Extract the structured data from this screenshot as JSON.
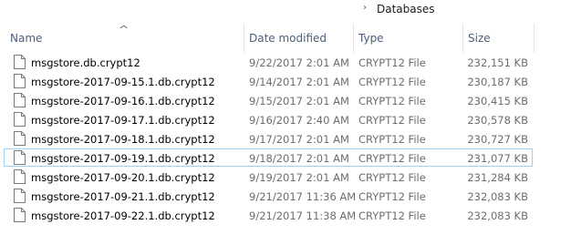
{
  "breadcrumb": {
    "separator": "›",
    "current": "Databases"
  },
  "columns": {
    "name": "Name",
    "date_modified": "Date modified",
    "type": "Type",
    "size": "Size"
  },
  "sort": {
    "column": "name",
    "glyph": "^"
  },
  "files": [
    {
      "name": "msgstore.db.crypt12",
      "date": "9/22/2017 2:01 AM",
      "type": "CRYPT12 File",
      "size": "232,151 KB",
      "selected": false
    },
    {
      "name": "msgstore-2017-09-15.1.db.crypt12",
      "date": "9/14/2017 2:01 AM",
      "type": "CRYPT12 File",
      "size": "230,187 KB",
      "selected": false
    },
    {
      "name": "msgstore-2017-09-16.1.db.crypt12",
      "date": "9/15/2017 2:01 AM",
      "type": "CRYPT12 File",
      "size": "230,415 KB",
      "selected": false
    },
    {
      "name": "msgstore-2017-09-17.1.db.crypt12",
      "date": "9/16/2017 2:40 AM",
      "type": "CRYPT12 File",
      "size": "230,578 KB",
      "selected": false
    },
    {
      "name": "msgstore-2017-09-18.1.db.crypt12",
      "date": "9/17/2017 2:01 AM",
      "type": "CRYPT12 File",
      "size": "230,727 KB",
      "selected": false
    },
    {
      "name": "msgstore-2017-09-19.1.db.crypt12",
      "date": "9/18/2017 2:01 AM",
      "type": "CRYPT12 File",
      "size": "231,077 KB",
      "selected": true
    },
    {
      "name": "msgstore-2017-09-20.1.db.crypt12",
      "date": "9/19/2017 2:01 AM",
      "type": "CRYPT12 File",
      "size": "231,284 KB",
      "selected": false
    },
    {
      "name": "msgstore-2017-09-21.1.db.crypt12",
      "date": "9/21/2017 11:36 AM",
      "type": "CRYPT12 File",
      "size": "232,083 KB",
      "selected": false
    },
    {
      "name": "msgstore-2017-09-22.1.db.crypt12",
      "date": "9/21/2017 11:38 AM",
      "type": "CRYPT12 File",
      "size": "232,083 KB",
      "selected": false
    }
  ],
  "icons": {
    "file": "file-icon",
    "sort": "sort-ascending-icon",
    "separator": "chevron-right-icon"
  },
  "colors": {
    "header_text": "#4c607a",
    "secondary_text": "#6d6d6d",
    "selection_border": "#99d1ff"
  }
}
